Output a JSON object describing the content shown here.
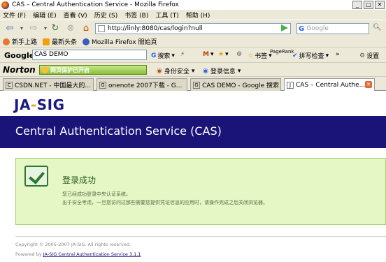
{
  "window": {
    "title": "CAS – Central Authentication Service - Mozilla Firefox",
    "controls": [
      "_",
      "□",
      "✕"
    ]
  },
  "menu": [
    "文件 (F)",
    "编辑 (E)",
    "查看 (V)",
    "历史 (S)",
    "书签 (B)",
    "工具 (T)",
    "帮助 (H)"
  ],
  "nav": {
    "url": "http://linly:8080/cas/login?null",
    "search_placeholder": "Google",
    "search_engine": "G"
  },
  "bookmarks": [
    {
      "label": "新手上路",
      "icon": "firefox-icon",
      "color": "#e8772e"
    },
    {
      "label": "最新头条",
      "icon": "rss-icon",
      "color": "#f59e0b"
    },
    {
      "label": "Mozilla Firefox 開始頁",
      "icon": "mozilla-icon",
      "color": "#3b5bbf"
    }
  ],
  "google_toolbar": {
    "logo": "Google",
    "search_value": "CAS DEMO",
    "search_label": "搜索",
    "bookmark_label": "书签",
    "pagerank_label": "PageRank",
    "spellcheck_label": "拼写检查",
    "more_label": "»",
    "settings_label": "设置"
  },
  "norton_toolbar": {
    "logo": "Norton",
    "status": "网页保护已开启",
    "identity_label": "身份安全",
    "login_label": "登录信息"
  },
  "tabs": [
    {
      "label": "CSDN.NET - 中国最大的...",
      "favicon": "C"
    },
    {
      "label": "onenote 2007下载 - G...",
      "favicon": "G"
    },
    {
      "label": "CAS DEMO - Google 搜索",
      "favicon": "G"
    },
    {
      "label": "CAS – Central Authe...",
      "favicon": "J"
    }
  ],
  "page": {
    "logo_left": "JA",
    "logo_dash": "-",
    "logo_right": "SIG",
    "banner_title": "Central Authentication Service (CAS)",
    "success_title": "登录成功",
    "success_msg1": "您已经成功登录中央认证系统。",
    "success_msg2": "出于安全考虑，一旦您访问过那些需要您提供凭证信息的应用时，请操作完成之后关闭浏览器。",
    "copyright": "Copyright © 2005-2007 JA-SIG. All rights reserved.",
    "powered_prefix": "Powered by ",
    "powered_link": "JA-SIG Central Authentication Service 3.1.1"
  }
}
